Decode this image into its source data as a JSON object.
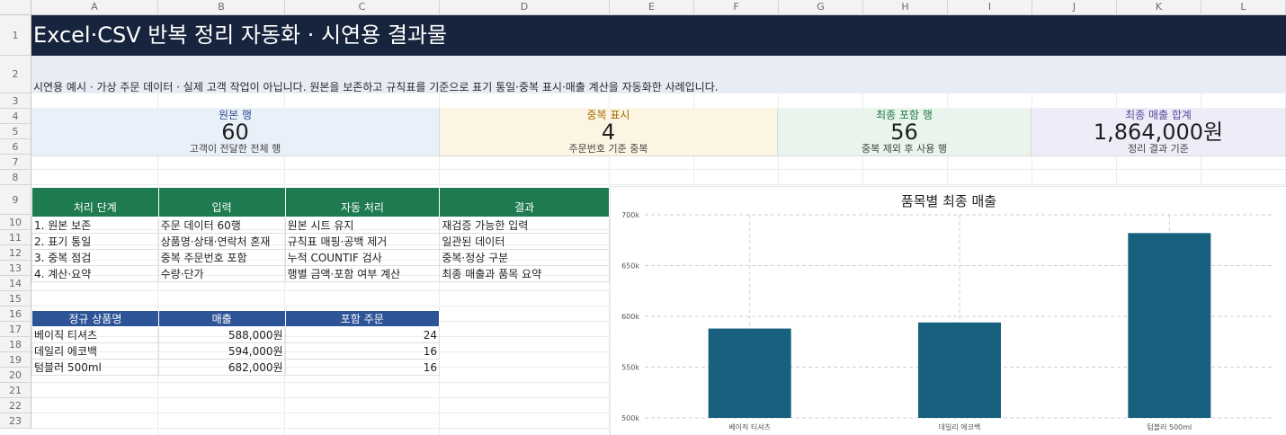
{
  "columns": [
    "A",
    "B",
    "C",
    "D",
    "E",
    "F",
    "G",
    "H",
    "I",
    "J",
    "K",
    "L"
  ],
  "rows": [
    "1",
    "2",
    "3",
    "4",
    "5",
    "6",
    "7",
    "8",
    "9",
    "10",
    "11",
    "12",
    "13",
    "14",
    "15",
    "16",
    "17",
    "18",
    "19",
    "20",
    "21",
    "22",
    "23"
  ],
  "title": "Excel·CSV 반복 정리 자동화 · 시연용 결과물",
  "note": "시연용 예시 · 가상 주문 데이터 · 실제 고객 작업이 아닙니다. 원본을 보존하고 규칙표를 기준으로 표기 통일·중복 표시·매출 계산을 자동화한 사례입니다.",
  "kpis": [
    {
      "label": "원본 행",
      "value": "60",
      "sub": "고객이 전달한 전체 행",
      "bg": "#e9f0fa",
      "label_color": "#2f4f8f"
    },
    {
      "label": "중복 표시",
      "value": "4",
      "sub": "주문번호 기준 중복",
      "bg": "#fdf5e3",
      "label_color": "#a26b00"
    },
    {
      "label": "최종 포함 행",
      "value": "56",
      "sub": "중복 제외 후 사용 행",
      "bg": "#e8f4ec",
      "label_color": "#1f7a45"
    },
    {
      "label": "최종 매출 합계",
      "value": "1,864,000원",
      "sub": "정리 결과 기준",
      "bg": "#efecfa",
      "label_color": "#5a4a9a"
    }
  ],
  "process": {
    "headers": [
      "처리 단계",
      "입력",
      "자동 처리",
      "결과"
    ],
    "header_bg": "#1e7a4f",
    "rows": [
      [
        "1. 원본 보존",
        "주문 데이터 60행",
        "원본 시트 유지",
        "재검증 가능한 입력"
      ],
      [
        "2. 표기 통일",
        "상품명·상태·연락처 혼재",
        "규칙표 매핑·공백 제거",
        "일관된 데이터"
      ],
      [
        "3. 중복 점검",
        "중복 주문번호 포함",
        "누적 COUNTIF 검사",
        "중복·정상 구분"
      ],
      [
        "4. 계산·요약",
        "수량·단가",
        "행별 금액·포함 여부 계산",
        "최종 매출과 품목 요약"
      ]
    ]
  },
  "summary": {
    "headers": [
      "정규 상품명",
      "매출",
      "포함 주문"
    ],
    "header_bg": "#2c5496",
    "rows": [
      [
        "베이직 티셔츠",
        "588,000원",
        "24"
      ],
      [
        "데일리 에코백",
        "594,000원",
        "16"
      ],
      [
        "텀블러 500ml",
        "682,000원",
        "16"
      ]
    ]
  },
  "chart_data": {
    "type": "bar",
    "title": "품목별 최종 매출",
    "categories": [
      "베이직 티셔츠",
      "데일리 에코백",
      "텀블러 500ml"
    ],
    "values": [
      588000,
      594000,
      682000
    ],
    "ylim": [
      500000,
      700000
    ],
    "yticks": [
      500000,
      550000,
      600000,
      650000,
      700000
    ],
    "ytick_labels": [
      "500k",
      "550k",
      "600k",
      "650k",
      "700k"
    ],
    "bar_color": "#17617f",
    "grid": true,
    "legend": "none"
  }
}
